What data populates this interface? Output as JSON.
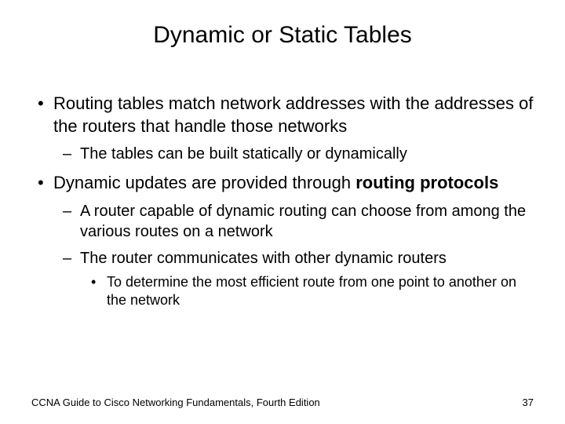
{
  "title": "Dynamic or Static Tables",
  "b1": {
    "text": "Routing tables match network addresses with the addresses of the routers that handle those networks",
    "sub1": "The tables can be built statically or dynamically"
  },
  "b2": {
    "pre": "Dynamic updates are provided through ",
    "bold": "routing protocols",
    "sub1": "A router capable of dynamic routing can choose from among the various routes on a network",
    "sub2": "The router communicates with other dynamic routers",
    "sub2_a": "To determine the most efficient route from one point to another on the network"
  },
  "footer": {
    "left": "CCNA Guide to Cisco Networking Fundamentals, Fourth Edition",
    "right": "37"
  }
}
